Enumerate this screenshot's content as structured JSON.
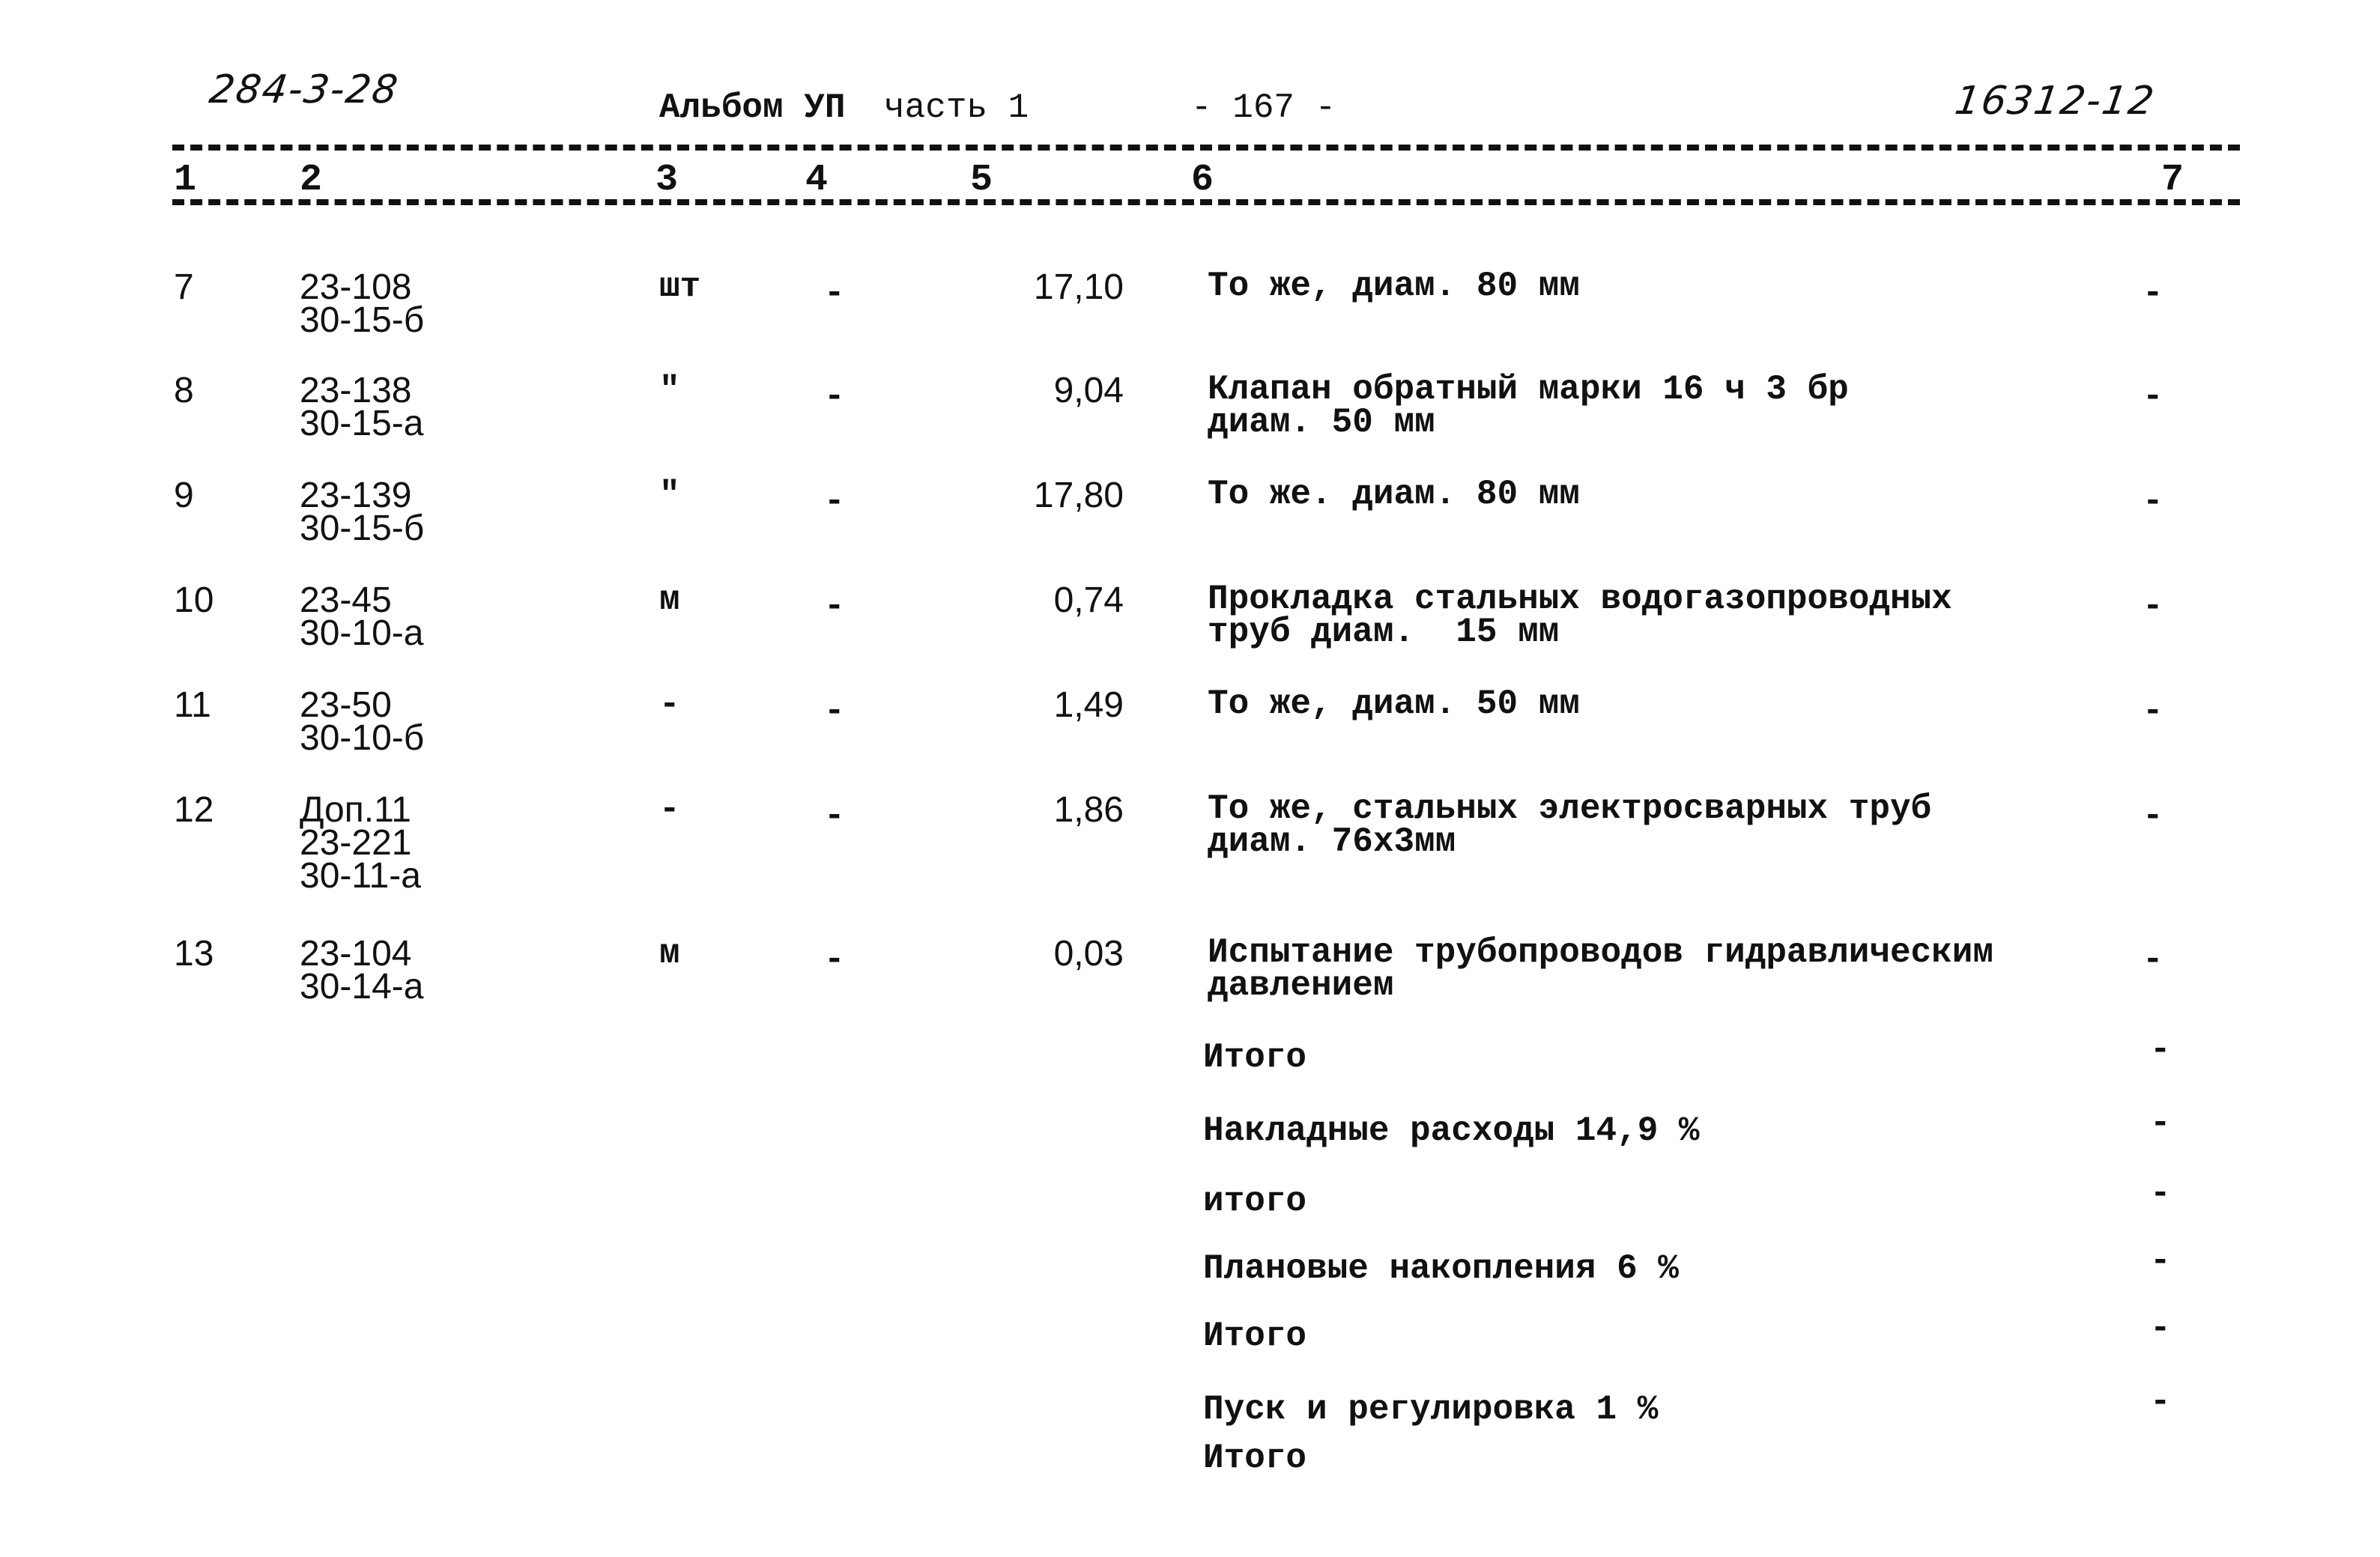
{
  "header": {
    "doc_code": "284-3-28",
    "album": "Альбом УП",
    "part": "часть 1",
    "page": "- 167 -",
    "sheet_code": "16312-12"
  },
  "columns": [
    "1",
    "2",
    "3",
    "4",
    "5",
    "6",
    "7"
  ],
  "rows": [
    {
      "no": "7",
      "code": [
        "23-108",
        "30-15-б"
      ],
      "unit": "шт",
      "col4": "-",
      "value": "17,10",
      "desc": [
        "То же, диам. 80 мм"
      ],
      "col7": "-"
    },
    {
      "no": "8",
      "code": [
        "23-138",
        "30-15-а"
      ],
      "unit": "\"",
      "col4": "-",
      "value": "9,04",
      "desc": [
        "Клапан обратный марки 16 ч 3 бр",
        "диам. 50 мм"
      ],
      "col7": "-"
    },
    {
      "no": "9",
      "code": [
        "23-139",
        "30-15-б"
      ],
      "unit": "\"",
      "col4": "-",
      "value": "17,80",
      "desc": [
        "То же. диам. 80 мм"
      ],
      "col7": "-"
    },
    {
      "no": "10",
      "code": [
        "23-45",
        "30-10-а"
      ],
      "unit": "м",
      "col4": "-",
      "value": "0,74",
      "desc": [
        "Прокладка стальных водогазопроводных",
        "труб диам.  15 мм"
      ],
      "col7": "-"
    },
    {
      "no": "11",
      "code": [
        "23-50",
        "30-10-б"
      ],
      "unit": "-",
      "col4": "-",
      "value": "1,49",
      "desc": [
        "То же, диам. 50 мм"
      ],
      "col7": "-"
    },
    {
      "no": "12",
      "code": [
        "Доп.11",
        "23-221",
        "30-11-а"
      ],
      "unit": "-",
      "col4": "-",
      "value": "1,86",
      "desc": [
        "То же, стальных электросварных труб",
        "диам. 76х3мм"
      ],
      "col7": "-"
    },
    {
      "no": "13",
      "code": [
        "23-104",
        "30-14-а"
      ],
      "unit": "м",
      "col4": "-",
      "value": "0,03",
      "desc": [
        "Испытание трубопроводов гидравлическим",
        "давлением"
      ],
      "col7": "-"
    }
  ],
  "totals": [
    {
      "label": "Итого",
      "col7": "-"
    },
    {
      "label": "Накладные расходы 14,9 %",
      "col7": "-"
    },
    {
      "label": "итого",
      "col7": "-"
    },
    {
      "label": "Плановые накопления 6 %",
      "col7": "-"
    },
    {
      "label": "Итого",
      "col7": "-"
    },
    {
      "label": "Пуск и регулировка 1 %",
      "col7": "-"
    },
    {
      "label": "Итого",
      "col7": ""
    }
  ]
}
